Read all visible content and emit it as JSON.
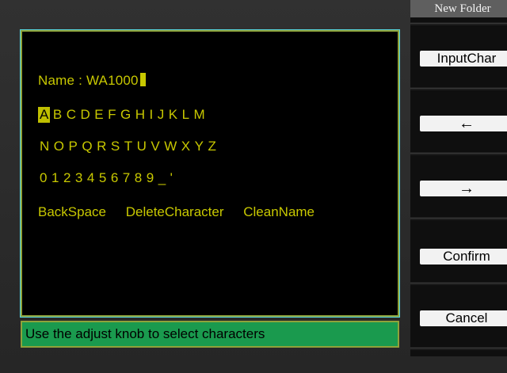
{
  "panel": {
    "title": "New Folder",
    "softkeys": {
      "input_char": "InputChar",
      "left_arrow": "←",
      "right_arrow": "→",
      "confirm": "Confirm",
      "cancel": "Cancel"
    }
  },
  "dialog": {
    "name_label": "Name :",
    "name_value": "WA1000",
    "rows": [
      [
        "A",
        "B",
        "C",
        "D",
        "E",
        "F",
        "G",
        "H",
        "I",
        "J",
        "K",
        "L",
        "M"
      ],
      [
        "N",
        "O",
        "P",
        "Q",
        "R",
        "S",
        "T",
        "U",
        "V",
        "W",
        "X",
        "Y",
        "Z"
      ],
      [
        "0",
        "1",
        "2",
        "3",
        "4",
        "5",
        "6",
        "7",
        "8",
        "9",
        "_",
        "'"
      ]
    ],
    "selected_char": "A",
    "actions": {
      "backspace": "BackSpace",
      "delete_character": "DeleteCharacter",
      "clean_name": "CleanName"
    }
  },
  "status": {
    "message": "Use the adjust knob to select characters"
  },
  "colors": {
    "text_yellow": "#c8c800",
    "status_green": "#1a9a4e",
    "border_olive": "#8fa23a"
  }
}
